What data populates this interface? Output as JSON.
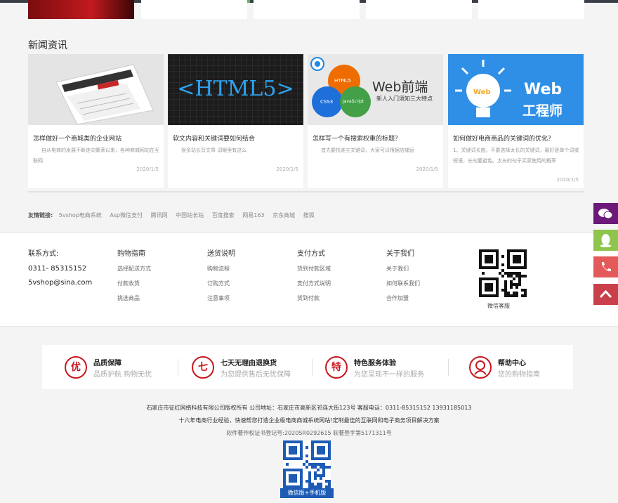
{
  "news": {
    "title": "新闻资讯",
    "items": [
      {
        "title": "怎样做好一个商城类的企业网站",
        "desc": "自从电商的发展不断走向繁荣以来，各种商城网站在互联网",
        "date": "2020/1/5"
      },
      {
        "title": "软文内容和关键词要如何结合",
        "desc": "很多站长写文章 词眼里有这么",
        "date": "2020/1/5",
        "thumb_text": "<HTML5>"
      },
      {
        "title": "怎样写一个有搜索权重的标题？",
        "desc": "首先要找准主关键词，大家可以根据店铺运",
        "date": "2020/1/5",
        "thumb_main": "Web前端",
        "thumb_sub": "新人入门须知三大特点",
        "bubbles": [
          "HTML5",
          "CSS3",
          "JavaScript"
        ]
      },
      {
        "title": "如何做好电商商品的关键词的优化？",
        "desc": "1、关键词长度。不要选择太长的关键词，最好是单个词或短语，长句要避免。太长的句子买家使用的概率",
        "date": "2020/1/5",
        "thumb_main": "Web",
        "thumb_sub": "工程师",
        "bulb_text": "Web"
      }
    ]
  },
  "friend_links": {
    "label": "友情链接:",
    "items": [
      "5vshop电商系统",
      "Asp微信支付",
      "腾讯网",
      "中国站长站",
      "百度搜索",
      "网易163",
      "京东商城",
      "搜狐"
    ]
  },
  "footer": {
    "contact": {
      "heading": "联系方式:",
      "phone": "0311- 85315152",
      "email": "5vshop@sina.com"
    },
    "columns": [
      {
        "heading": "购物指南",
        "items": [
          "选择配送方式",
          "付款收货",
          "挑选商品"
        ]
      },
      {
        "heading": "送货说明",
        "items": [
          "购物流程",
          "订购方式",
          "注意事项"
        ]
      },
      {
        "heading": "支付方式",
        "items": [
          "货到付款区域",
          "支付方式说明",
          "货到付款"
        ]
      },
      {
        "heading": "关于我们",
        "items": [
          "关于我们",
          "如何联系我们",
          "合作加盟"
        ]
      }
    ],
    "wechat_caption": "微信客服"
  },
  "guarantees": [
    {
      "icon_char": "优",
      "title": "品质保障",
      "sub": "品质护航 购物无忧"
    },
    {
      "icon_char": "七",
      "title": "七天无理由退换货",
      "sub": "为您提供售后无忧保障"
    },
    {
      "icon_char": "特",
      "title": "特色服务体验",
      "sub": "为您呈现不一样的服务"
    },
    {
      "icon_char": "",
      "title": "帮助中心",
      "sub": "您的购物指南"
    }
  ],
  "copyright": {
    "line1": "石家庄市征红网络科技有限公司版权所有 公司地址：石家庄市高新区祁连大街123号 客服电话：0311-85315152 13931185013",
    "line2": "十六年电商行业经验，快速帮您打造企业级电商商城系统网站!定制最佳的互联网和电子商务项目解决方案",
    "line3": "软件著作权证书登记号:2020SR0292615 软著登字第5171311号",
    "qr_caption": "微信版+手机版"
  },
  "sidebar": [
    {
      "icon": "wechat-icon",
      "color": "#6b1a7a"
    },
    {
      "icon": "qq-icon",
      "color": "#8fc44d"
    },
    {
      "icon": "phone-icon",
      "color": "#e45a5a"
    },
    {
      "icon": "back-to-top-icon",
      "color": "#c9404a"
    }
  ],
  "colors": {
    "accent": "#c9151e",
    "footer_bg": "#ffffff",
    "page_bg": "#f4f4f4"
  }
}
